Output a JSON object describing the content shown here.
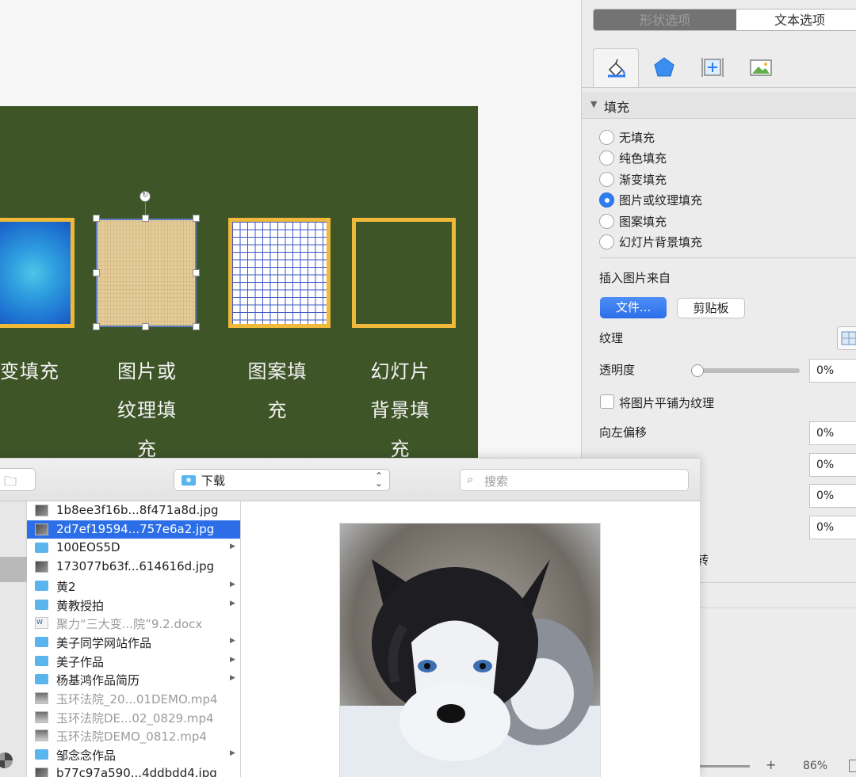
{
  "slide": {
    "labels": {
      "gradient": "变填充",
      "texture_line1": "图片或",
      "texture_line2": "纹理填",
      "texture_line3": "充",
      "pattern_line1": "图案填",
      "pattern_line2": "充",
      "slidebg_line1": "幻灯片",
      "slidebg_line2": "背景填",
      "slidebg_line3": "充"
    },
    "colors": {
      "background": "#3e5528",
      "outline": "#f1b93a",
      "pattern_lines": "#3d57c4",
      "selection": "#5b7dc4"
    }
  },
  "inspector": {
    "tabs": {
      "shape_options": "形状选项",
      "text_options": "文本选项"
    },
    "icon_tabs": [
      "fill-icon",
      "shape-icon",
      "size-icon",
      "picture-icon"
    ],
    "fill_section": {
      "title": "填充",
      "options": [
        {
          "label": "无填充",
          "selected": false
        },
        {
          "label": "纯色填充",
          "selected": false
        },
        {
          "label": "渐变填充",
          "selected": false
        },
        {
          "label": "图片或纹理填充",
          "selected": true
        },
        {
          "label": "图案填充",
          "selected": false
        },
        {
          "label": "幻灯片背景填充",
          "selected": false
        }
      ]
    },
    "insert_picture_from": "插入图片来自",
    "file_button": "文件...",
    "clipboard_button": "剪贴板",
    "texture_label": "纹理",
    "transparency_label": "透明度",
    "transparency_value": "0%",
    "transparency_level": 0,
    "tile_checkbox_label": "将图片平铺为纹理",
    "tile_checked": false,
    "offset_left_label": "向左偏移",
    "offset_values": [
      "0%",
      "0%",
      "0%",
      "0%"
    ],
    "rotate_partial": "转"
  },
  "statusbar": {
    "zoom_plus": "+",
    "zoom_value": "86%"
  },
  "dialog": {
    "location": "下载",
    "search_placeholder": "搜索",
    "files": [
      {
        "name": "1b8ee3f16b...8f471a8d.jpg",
        "type": "image",
        "selected": false,
        "dim": false,
        "has_children": false
      },
      {
        "name": "2d7ef19594...757e6a2.jpg",
        "type": "image",
        "selected": true,
        "dim": false,
        "has_children": false
      },
      {
        "name": "100EOS5D",
        "type": "folder",
        "selected": false,
        "dim": false,
        "has_children": true
      },
      {
        "name": "173077b63f...614616d.jpg",
        "type": "image",
        "selected": false,
        "dim": false,
        "has_children": false
      },
      {
        "name": "黄2",
        "type": "folder",
        "selected": false,
        "dim": false,
        "has_children": true
      },
      {
        "name": "黄教授拍",
        "type": "folder",
        "selected": false,
        "dim": false,
        "has_children": true
      },
      {
        "name": "聚力“三大变...院”9.2.docx",
        "type": "doc",
        "selected": false,
        "dim": true,
        "has_children": false
      },
      {
        "name": "美子同学网站作品",
        "type": "folder",
        "selected": false,
        "dim": false,
        "has_children": true
      },
      {
        "name": "美子作品",
        "type": "folder",
        "selected": false,
        "dim": false,
        "has_children": true
      },
      {
        "name": "杨基鸿作品简历",
        "type": "folder",
        "selected": false,
        "dim": false,
        "has_children": true
      },
      {
        "name": "玉环法院_20...01DEMO.mp4",
        "type": "video",
        "selected": false,
        "dim": true,
        "has_children": false
      },
      {
        "name": "玉环法院DE...02_0829.mp4",
        "type": "video",
        "selected": false,
        "dim": true,
        "has_children": false
      },
      {
        "name": "玉环法院DEMO_0812.mp4",
        "type": "video",
        "selected": false,
        "dim": true,
        "has_children": false
      },
      {
        "name": "邹念念作品",
        "type": "folder",
        "selected": false,
        "dim": false,
        "has_children": true
      },
      {
        "name": "b77c97a590...4ddbdd4.jpg",
        "type": "image",
        "selected": false,
        "dim": false,
        "has_children": false
      }
    ]
  }
}
